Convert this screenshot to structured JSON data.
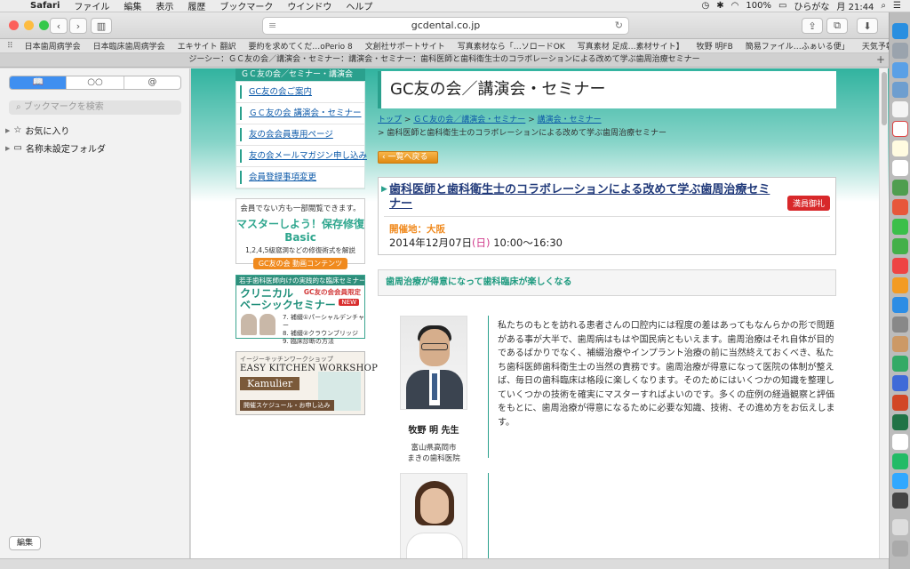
{
  "menubar": {
    "app": "Safari",
    "items": [
      "ファイル",
      "編集",
      "表示",
      "履歴",
      "ブックマーク",
      "ウインドウ",
      "ヘルプ"
    ],
    "battery": "100%",
    "input_method": "ひらがな",
    "clock": "月 21:44"
  },
  "toolbar": {
    "url": "gcdental.co.jp"
  },
  "bookmarks": [
    "日本歯周病学会",
    "日本臨床歯周病学会",
    "エキサイト 翻訳",
    "要約を求めてくだ…oPerio 8",
    "文創社サポートサイト",
    "写真素材なら「…ソロードOK",
    "写真素材 足成…素材サイト】",
    "牧野 明FB",
    "簡易ファイル…ふぁいる便」",
    "天気予報 - …ーニュース：風"
  ],
  "tab": {
    "title": "ジーシー：ＧＣ友の会／講演会・セミナー：講演会・セミナー：歯科医師と歯科衛生士のコラボレーションによる改めて学ぶ歯周治療セミナー"
  },
  "sidebar": {
    "search_placeholder": "ブックマークを検索",
    "items": [
      "お気に入り",
      "名称未設定フォルダ"
    ],
    "edit_label": "編集"
  },
  "left_nav": {
    "top_cropped": "ＧＣ友の会／セミナー・講演会",
    "items": [
      "GC友の会ご案内",
      "ＧＣ友の会 講演会・セミナー",
      "友の会会員専用ページ",
      "友の会メールマガジン申し込み",
      "会員登録事項変更"
    ]
  },
  "banner_basic": {
    "line1": "会員でない方も一部閲覧できます。",
    "line2": "マスターしよう！保存修復Basic",
    "line3": "1,2,4,5級窩洞などの修復術式を解説",
    "line4": "GC友の会 動画コンテンツ"
  },
  "banner_clinical": {
    "header": "若手歯科医師向けの実践的な臨床セミナー",
    "title_line1": "クリニカル",
    "title_line2": "ベーシックセミナー",
    "limited": "GC友の会会員限定",
    "new_label": "NEW",
    "courses": [
      "7. 補綴①パーシャルデンチャー",
      "8. 補綴②クラウンブリッジ",
      "9. 臨床診断の方法"
    ]
  },
  "banner_kitchen": {
    "subtitle": "イージーキッチンワークショップ",
    "title": "EASY KITCHEN WORKSHOP",
    "brand": "Kamulier",
    "cta": "開催スケジュール・お申し込み"
  },
  "main": {
    "page_title": "GC友の会／講演会・セミナー",
    "breadcrumb": [
      "トップ",
      "ＧＣ友の会／講演会・セミナー",
      "講演会・セミナー"
    ],
    "breadcrumb_current": "歯科医師と歯科衛生士のコラボレーションによる改めて学ぶ歯周治療セミナー",
    "back_label": "一覧へ戻る",
    "event_title": "歯科医師と歯科衛生士のコラボレーションによる改めて学ぶ歯周治療セミナー",
    "badge": "満員御礼",
    "place": "開催地：大阪",
    "date": "2014年12月07日",
    "day": "(日)",
    "time": "10:00〜16:30",
    "tagline": "歯周治療が得意になって歯科臨床が楽しくなる",
    "speaker1": {
      "name": "牧野 明 先生",
      "affiliation1": "富山県高岡市",
      "affiliation2": "まきの歯科医院"
    },
    "bio": "私たちのもとを訪れる患者さんの口腔内には程度の差はあってもなんらかの形で問題がある事が大半で、歯周病はもはや国民病ともいえます。歯周治療はそれ自体が目的であるばかりでなく、補綴治療やインプラント治療の前に当然終えておくべき、私たち歯科医師歯科衛生士の当然の責務です。歯周治療が得意になって医院の体制が整えば、毎日の歯科臨床は格段に楽しくなります。そのためにはいくつかの知識を整理していくつかの技術を確実にマスターすればよいのです。多くの症例の経過観察と評価をもとに、歯周治療が得意になるために必要な知識、技術、その進め方をお伝えします。"
  }
}
